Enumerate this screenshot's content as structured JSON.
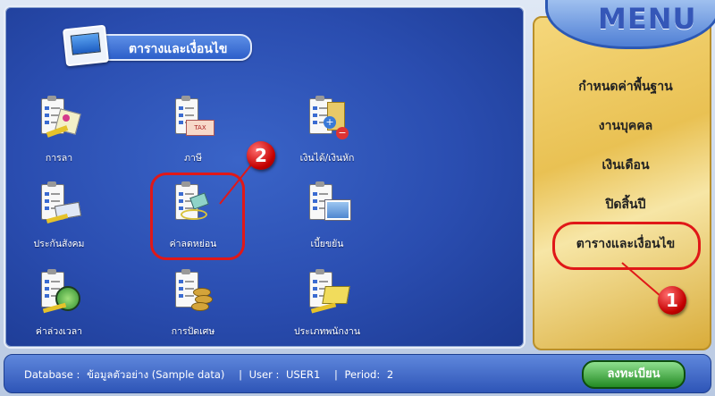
{
  "panel": {
    "title": "ตารางและเงื่อนไข"
  },
  "grid": {
    "items": [
      {
        "label": "การลา",
        "icon": "leave-icon"
      },
      {
        "label": "ภาษี",
        "icon": "tax-icon"
      },
      {
        "label": "เงินได้/เงินหัก",
        "icon": "income-deduction-icon"
      },
      {
        "label": "ประกันสังคม",
        "icon": "social-security-icon"
      },
      {
        "label": "ค่าลดหย่อน",
        "icon": "tax-allowance-icon"
      },
      {
        "label": "เบี้ยขยัน",
        "icon": "diligence-bonus-icon"
      },
      {
        "label": "ค่าล่วงเวลา",
        "icon": "overtime-clock-icon"
      },
      {
        "label": "การปัดเศษ",
        "icon": "rounding-coins-icon"
      },
      {
        "label": "ประเภทพนักงาน",
        "icon": "employee-type-icon"
      }
    ]
  },
  "menu": {
    "title": "MENU",
    "items": [
      {
        "label": "กำหนดค่าพื้นฐาน"
      },
      {
        "label": "งานบุคคล"
      },
      {
        "label": "เงินเดือน"
      },
      {
        "label": "ปิดสิ้นปี"
      },
      {
        "label": "ตารางและเงื่อนไข"
      }
    ]
  },
  "callouts": {
    "step1": "1",
    "step2": "2"
  },
  "status": {
    "database_label": "Database :",
    "database_value": "ข้อมูลตัวอย่าง (Sample data)",
    "user_label": "User :",
    "user_value": "USER1",
    "period_label": "Period:",
    "period_value": "2",
    "separator": "|",
    "register_label": "ลงทะเบียน"
  },
  "colors": {
    "accent_red": "#e01818",
    "panel_blue": "#2a4db0",
    "menu_gold": "#e9c153"
  }
}
